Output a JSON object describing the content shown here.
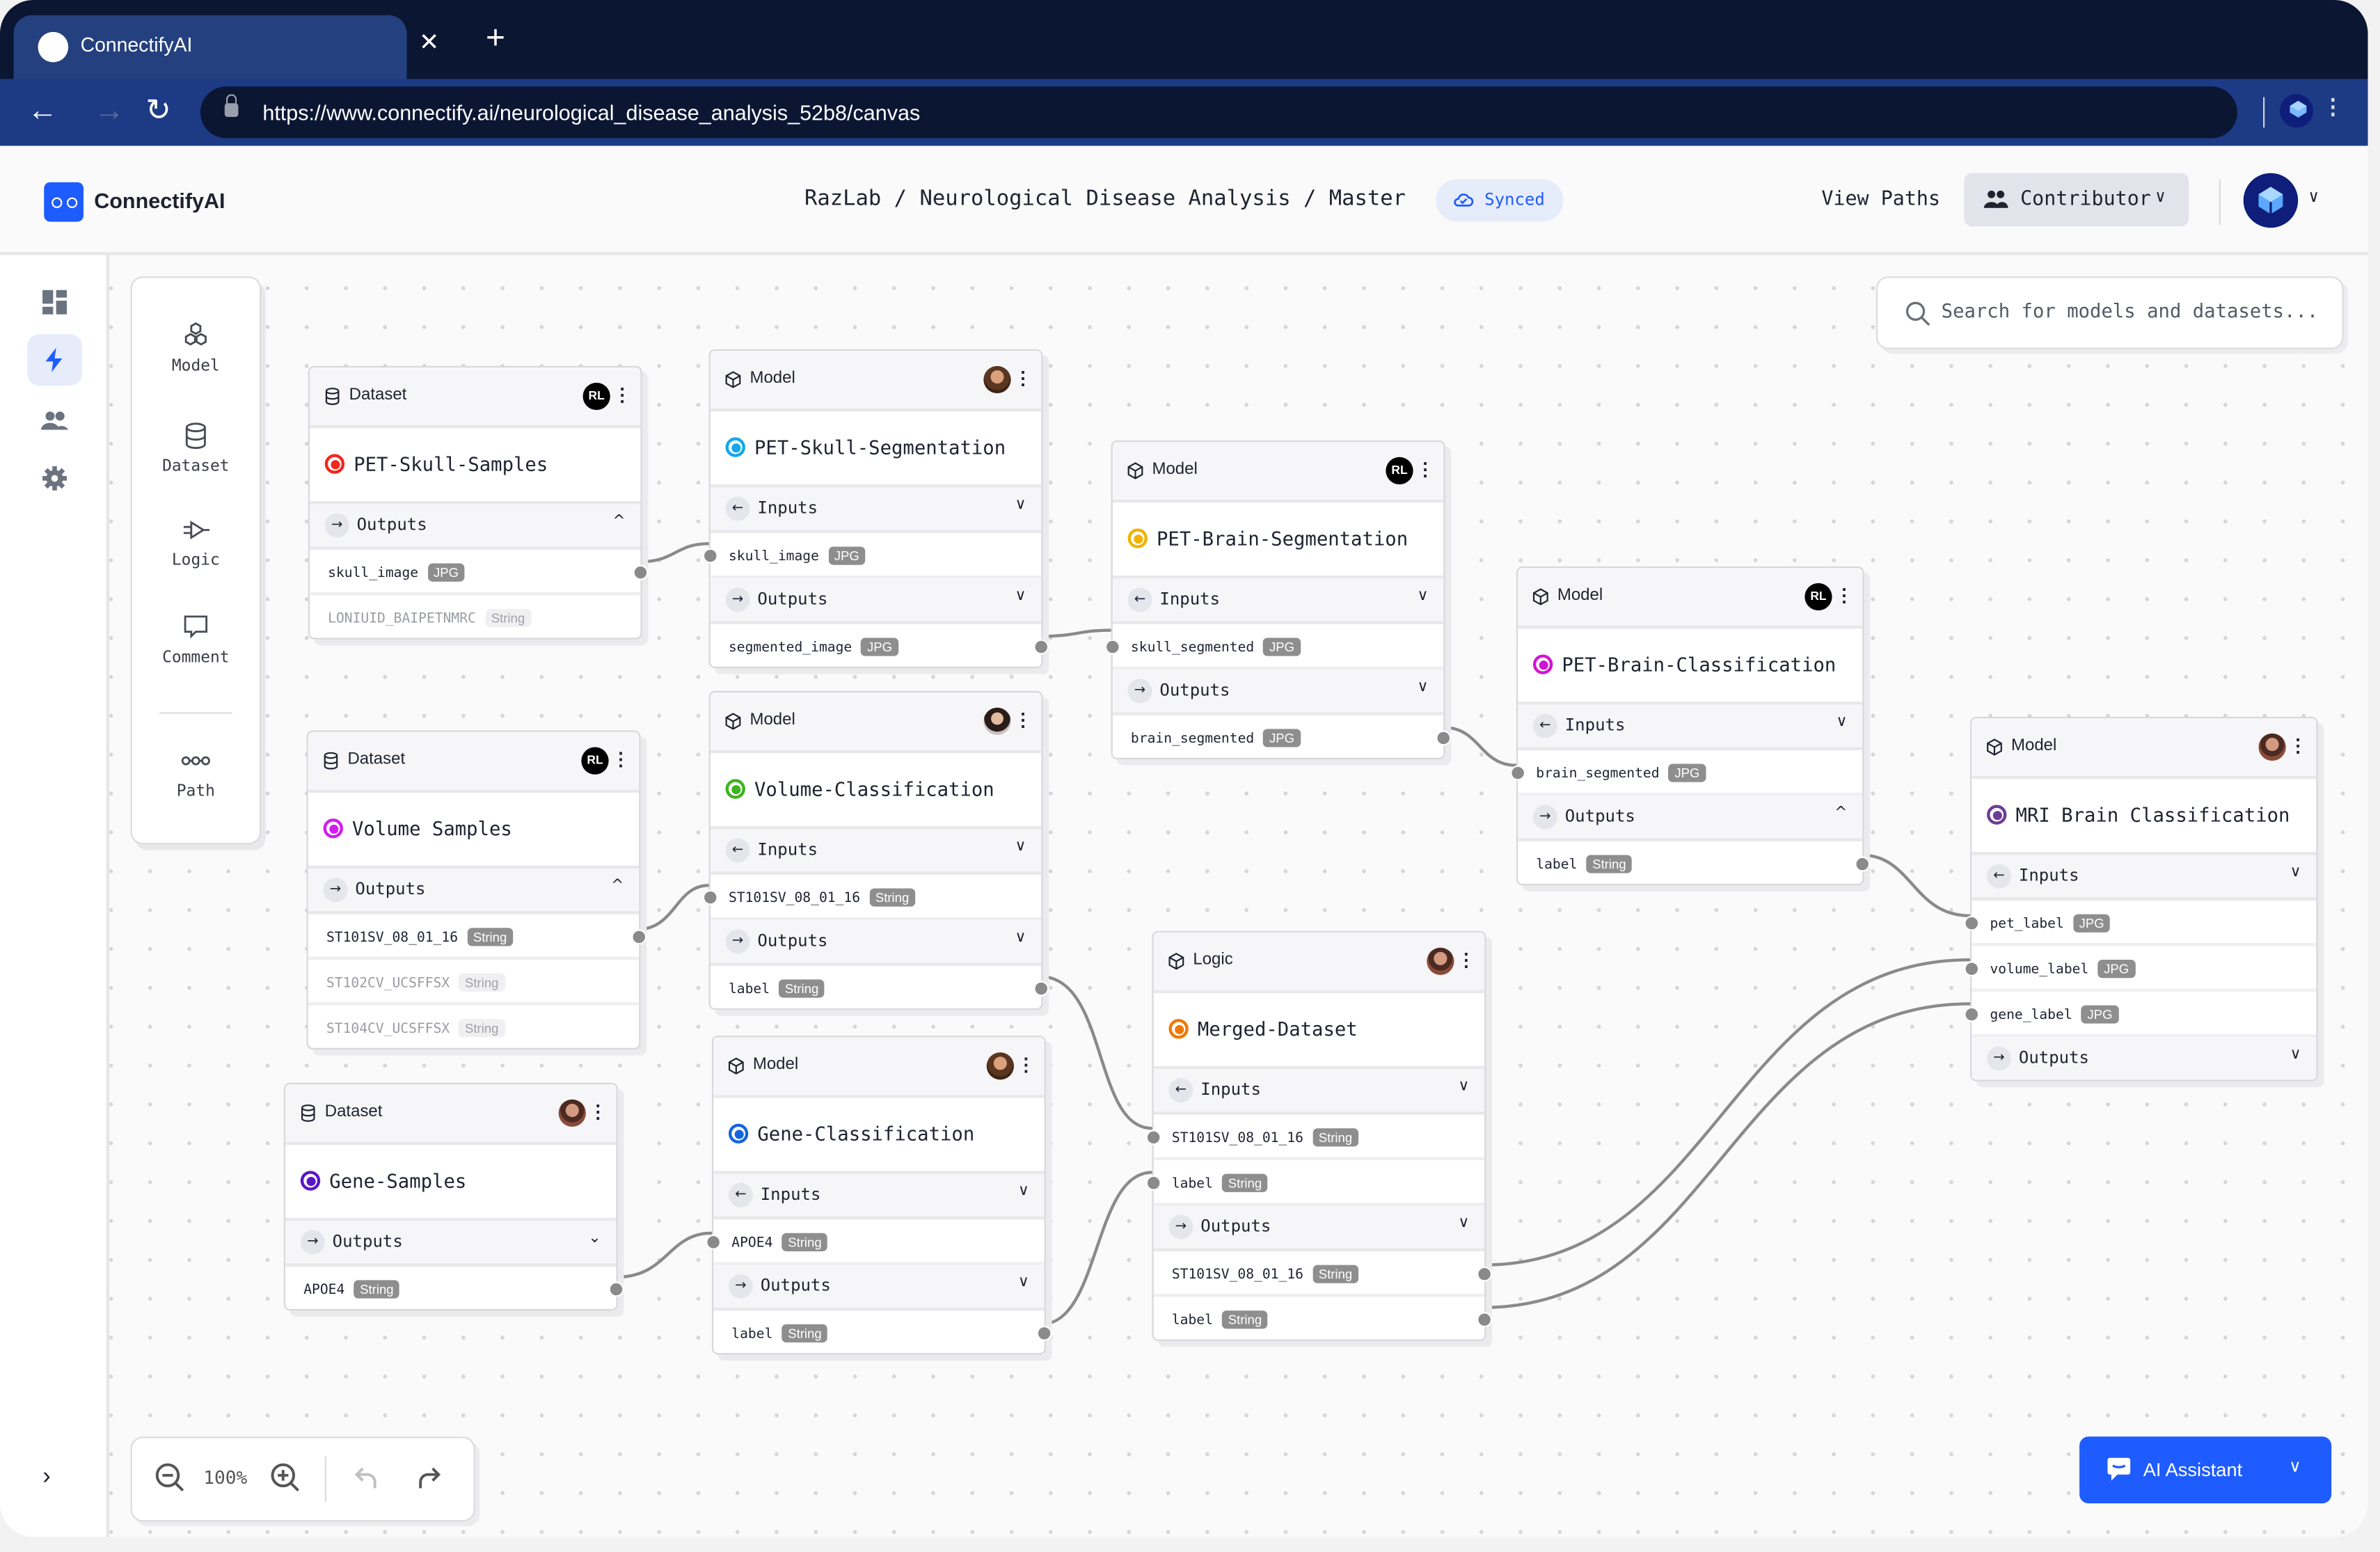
{
  "browser": {
    "tab_title": "ConnectifyAI",
    "close_glyph": "✕",
    "new_tab_glyph": "+",
    "back_glyph": "←",
    "forward_glyph": "→",
    "reload_glyph": "↻",
    "url": "https://www.connectify.ai/neurological_disease_analysis_52b8/canvas",
    "menu_glyph": "⋮"
  },
  "header": {
    "brand": "ConnectifyAI",
    "breadcrumb": "RazLab / Neurological Disease Analysis / Master",
    "sync_status": "Synced",
    "view_paths": "View Paths",
    "role": "Contributor",
    "chevron": "⌄"
  },
  "rail": {
    "items": [
      {
        "name": "dashboard",
        "icon": "dashboard-icon"
      },
      {
        "name": "flows",
        "icon": "lightning-icon",
        "active": true
      },
      {
        "name": "team",
        "icon": "people-icon"
      },
      {
        "name": "settings",
        "icon": "gear-icon"
      }
    ],
    "expand_glyph": "›"
  },
  "palette": {
    "items": [
      {
        "label": "Model",
        "icon": "cubes-icon"
      },
      {
        "label": "Dataset",
        "icon": "database-icon"
      },
      {
        "label": "Logic",
        "icon": "logic-gate-icon"
      },
      {
        "label": "Comment",
        "icon": "comment-icon"
      },
      {
        "label": "Path",
        "icon": "path-icon"
      }
    ]
  },
  "search": {
    "placeholder": "Search for models and datasets..."
  },
  "zoom": {
    "level": "100%"
  },
  "ai_assistant": {
    "label": "AI Assistant",
    "chevron": "⌄"
  },
  "colors": {
    "accent": "#1f5cff",
    "chrome_dark": "#0b1633",
    "chrome_tab": "#24407e",
    "edge": "#8a8a8a"
  },
  "nodes": {
    "pet_skull_samples": {
      "type": "Dataset",
      "owner": "RL",
      "name": "PET-Skull-Samples",
      "color": "#f0281e",
      "outputs_label": "Outputs",
      "outputs_open": "^",
      "outputs": [
        {
          "name": "skull_image",
          "type": "JPG"
        },
        {
          "name": "LONIUID_BAIPETNMRC",
          "type": "String",
          "dim": true
        }
      ]
    },
    "volume_samples": {
      "type": "Dataset",
      "owner": "RL",
      "name": "Volume Samples",
      "color": "#d21cf0",
      "outputs_label": "Outputs",
      "outputs_open": "^",
      "outputs": [
        {
          "name": "ST101SV_08_01_16",
          "type": "String"
        },
        {
          "name": "ST102CV_UCSFFSX",
          "type": "String",
          "dim": true
        },
        {
          "name": "ST104CV_UCSFFSX",
          "type": "String",
          "dim": true
        }
      ]
    },
    "gene_samples": {
      "type": "Dataset",
      "name": "Gene-Samples",
      "color": "#5a14c8",
      "outputs_label": "Outputs",
      "outputs_open": "⌄",
      "outputs": [
        {
          "name": "APOE4",
          "type": "String"
        }
      ]
    },
    "pet_skull_segmentation": {
      "type": "Model",
      "name": "PET-Skull-Segmentation",
      "color": "#14a8e6",
      "inputs_label": "Inputs",
      "outputs_label": "Outputs",
      "inputs": [
        {
          "name": "skull_image",
          "type": "JPG"
        }
      ],
      "outputs": [
        {
          "name": "segmented_image",
          "type": "JPG"
        }
      ]
    },
    "volume_classification": {
      "type": "Model",
      "name": "Volume-Classification",
      "color": "#3cb41e",
      "inputs_label": "Inputs",
      "outputs_label": "Outputs",
      "inputs": [
        {
          "name": "ST101SV_08_01_16",
          "type": "String"
        }
      ],
      "outputs": [
        {
          "name": "label",
          "type": "String"
        }
      ]
    },
    "gene_classification": {
      "type": "Model",
      "name": "Gene-Classification",
      "color": "#1464dc",
      "inputs_label": "Inputs",
      "outputs_label": "Outputs",
      "inputs": [
        {
          "name": "APOE4",
          "type": "String"
        }
      ],
      "outputs": [
        {
          "name": "label",
          "type": "String"
        }
      ]
    },
    "pet_brain_segmentation": {
      "type": "Model",
      "owner": "RL",
      "name": "PET-Brain-Segmentation",
      "color": "#f0b400",
      "inputs_label": "Inputs",
      "outputs_label": "Outputs",
      "inputs": [
        {
          "name": "skull_segmented",
          "type": "JPG"
        }
      ],
      "outputs": [
        {
          "name": "brain_segmented",
          "type": "JPG"
        }
      ]
    },
    "pet_brain_classification": {
      "type": "Model",
      "owner": "RL",
      "name": "PET-Brain-Classification",
      "color": "#d214d2",
      "inputs_label": "Inputs",
      "outputs_label": "Outputs",
      "outputs_open": "^",
      "inputs": [
        {
          "name": "brain_segmented",
          "type": "JPG"
        }
      ],
      "outputs": [
        {
          "name": "label",
          "type": "String"
        }
      ]
    },
    "merged_dataset": {
      "type": "Logic",
      "name": "Merged-Dataset",
      "color": "#f07800",
      "inputs_label": "Inputs",
      "outputs_label": "Outputs",
      "inputs": [
        {
          "name": "ST101SV_08_01_16",
          "type": "String"
        },
        {
          "name": "label",
          "type": "String"
        }
      ],
      "outputs": [
        {
          "name": "ST101SV_08_01_16",
          "type": "String"
        },
        {
          "name": "label",
          "type": "String"
        }
      ]
    },
    "mri_brain_classification": {
      "type": "Model",
      "name": "MRI Brain Classification",
      "color": "#6e3c96",
      "inputs_label": "Inputs",
      "outputs_label": "Outputs",
      "inputs": [
        {
          "name": "pet_label",
          "type": "JPG"
        },
        {
          "name": "volume_label",
          "type": "JPG"
        },
        {
          "name": "gene_label",
          "type": "JPG"
        }
      ]
    }
  },
  "connections": [
    {
      "from": "PET-Skull-Samples.skull_image",
      "to": "PET-Skull-Segmentation.skull_image"
    },
    {
      "from": "PET-Skull-Segmentation.segmented_image",
      "to": "PET-Brain-Segmentation.skull_segmented"
    },
    {
      "from": "PET-Brain-Segmentation.brain_segmented",
      "to": "PET-Brain-Classification.brain_segmented"
    },
    {
      "from": "PET-Brain-Classification.label",
      "to": "MRI Brain Classification.pet_label"
    },
    {
      "from": "Volume Samples.ST101SV_08_01_16",
      "to": "Volume-Classification.ST101SV_08_01_16"
    },
    {
      "from": "Volume-Classification.label",
      "to": "Merged-Dataset.ST101SV_08_01_16"
    },
    {
      "from": "Gene-Samples.APOE4",
      "to": "Gene-Classification.APOE4"
    },
    {
      "from": "Gene-Classification.label",
      "to": "Merged-Dataset.label"
    },
    {
      "from": "Merged-Dataset.ST101SV_08_01_16",
      "to": "MRI Brain Classification.volume_label"
    },
    {
      "from": "Merged-Dataset.label",
      "to": "MRI Brain Classification.gene_label"
    }
  ]
}
